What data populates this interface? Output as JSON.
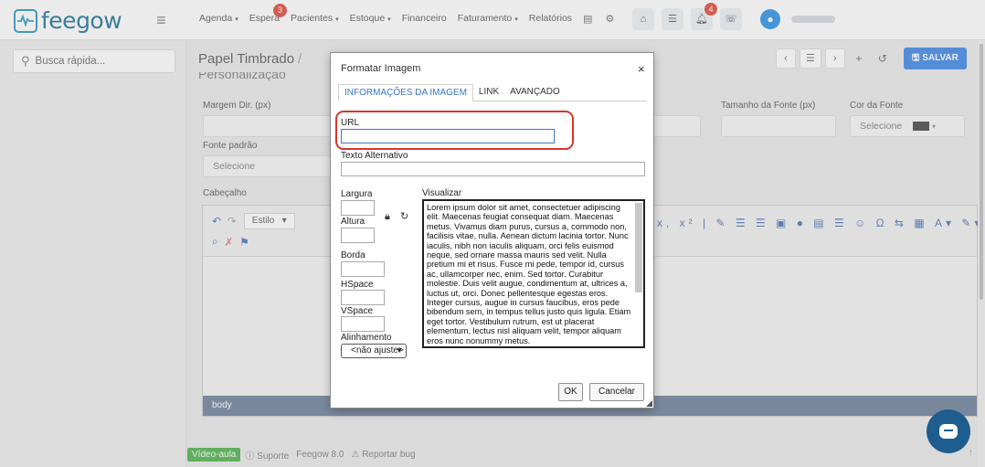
{
  "topbar": {
    "logo_text": "feegow",
    "nav": [
      {
        "label": "Agenda",
        "caret": "▾",
        "badge": ""
      },
      {
        "label": "Espera",
        "caret": "",
        "badge": "3"
      },
      {
        "label": "Pacientes",
        "caret": "▾",
        "badge": ""
      },
      {
        "label": "Estoque",
        "caret": "▾",
        "badge": ""
      },
      {
        "label": "Financeiro",
        "caret": "",
        "badge": ""
      },
      {
        "label": "Faturamento",
        "caret": "▾",
        "badge": ""
      },
      {
        "label": "Relatórios",
        "caret": "",
        "badge": ""
      }
    ],
    "notification_badge": "4"
  },
  "sidebar": {
    "search_placeholder": "Busca rápida..."
  },
  "main": {
    "page_title": "Papel Timbrado",
    "sub_title": "Personalização",
    "save_label": "SALVAR",
    "fields": {
      "margin_right_label": "Margem Dir. (px)",
      "font_size_label": "Tamanho da Fonte (px)",
      "font_color_label": "Cor da Fonte",
      "font_color_value": "Selecione",
      "default_font_label": "Fonte padrão",
      "default_font_value": "Selecione",
      "header_label": "Cabeçalho"
    },
    "editor": {
      "style_label": "Estilo",
      "footer_tag": "body"
    },
    "footer": {
      "video": "Vídeo-aula",
      "support": "Suporte",
      "version": "Feegow 8.0",
      "bug": "Reportar bug"
    }
  },
  "dialog": {
    "title": "Formatar Imagem",
    "close": "×",
    "tabs": [
      "INFORMAÇÕES DA IMAGEM",
      "LINK",
      "AVANÇADO"
    ],
    "url_label": "URL",
    "url_value": "",
    "alt_label": "Texto Alternativo",
    "alt_value": "",
    "width_label": "Largura",
    "height_label": "Altura",
    "border_label": "Borda",
    "hspace_label": "HSpace",
    "vspace_label": "VSpace",
    "align_label": "Alinhamento",
    "align_value": "<não ajuste>",
    "preview_label": "Visualizar",
    "preview_text": "Lorem ipsum dolor sit amet, consectetuer adipiscing elit. Maecenas feugiat consequat diam. Maecenas metus. Vivamus diam purus, cursus a, commodo non, facilisis vitae, nulla. Aenean dictum lacinia tortor. Nunc iaculis, nibh non iaculis aliquam, orci felis euismod neque, sed ornare massa mauris sed velit. Nulla pretium mi et risus. Fusce mi pede, tempor id, cursus ac, ullamcorper nec, enim. Sed tortor. Curabitur molestie. Duis velit augue, condimentum at, ultrices a, luctus ut, orci. Donec pellentesque egestas eros. Integer cursus, augue in cursus faucibus, eros pede bibendum sem, in tempus tellus justo quis ligula. Etiam eget tortor. Vestibulum rutrum, est ut placerat elementum, lectus nisl aliquam velit, tempor aliquam eros nunc nonummy metus.",
    "ok_label": "OK",
    "cancel_label": "Cancelar"
  }
}
